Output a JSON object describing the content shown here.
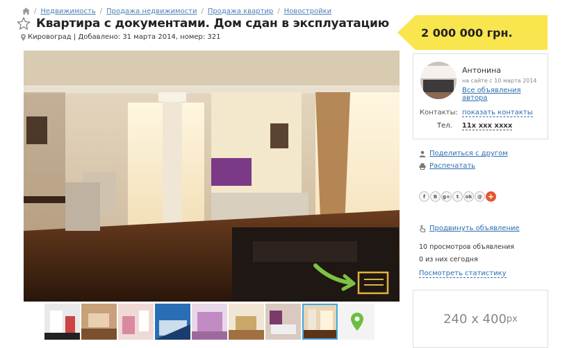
{
  "breadcrumb": [
    "Недвижимость",
    "Продажа недвижимости",
    "Продажа квартир",
    "Новостройки"
  ],
  "listing": {
    "title": "Квартира с документами. Дом сдан в эксплуатацию",
    "meta": "Кировоград | Добавлено: 31 марта 2014, номер: 321",
    "price": "2 000 000 грн."
  },
  "seller": {
    "name": "Антонина",
    "since": "на сайте с 10 марта 2014",
    "all_ads": "Все объявления автора",
    "contacts_label": "Контакты:",
    "contacts_link": "показать контакты",
    "tel_label": "Тел.",
    "tel_value": "11х ххх хххх"
  },
  "actions": {
    "share": "Поделиться с другом",
    "print": "Распечатать",
    "promote": "Продвинуть объявление"
  },
  "socials": [
    "f",
    "B",
    "g+",
    "t",
    "ok",
    "@",
    "+"
  ],
  "stats": {
    "views": "10 просмотров объявления",
    "today": "0 из них сегодня",
    "link": "Посмотреть статистику"
  },
  "ad": {
    "size": "240 x 400",
    "unit": "px"
  },
  "colors": {
    "link": "#2b6cb0",
    "price_bg": "#f9e54d",
    "active_thumb": "#3fa6e0",
    "map_pin": "#6cbf3f"
  }
}
